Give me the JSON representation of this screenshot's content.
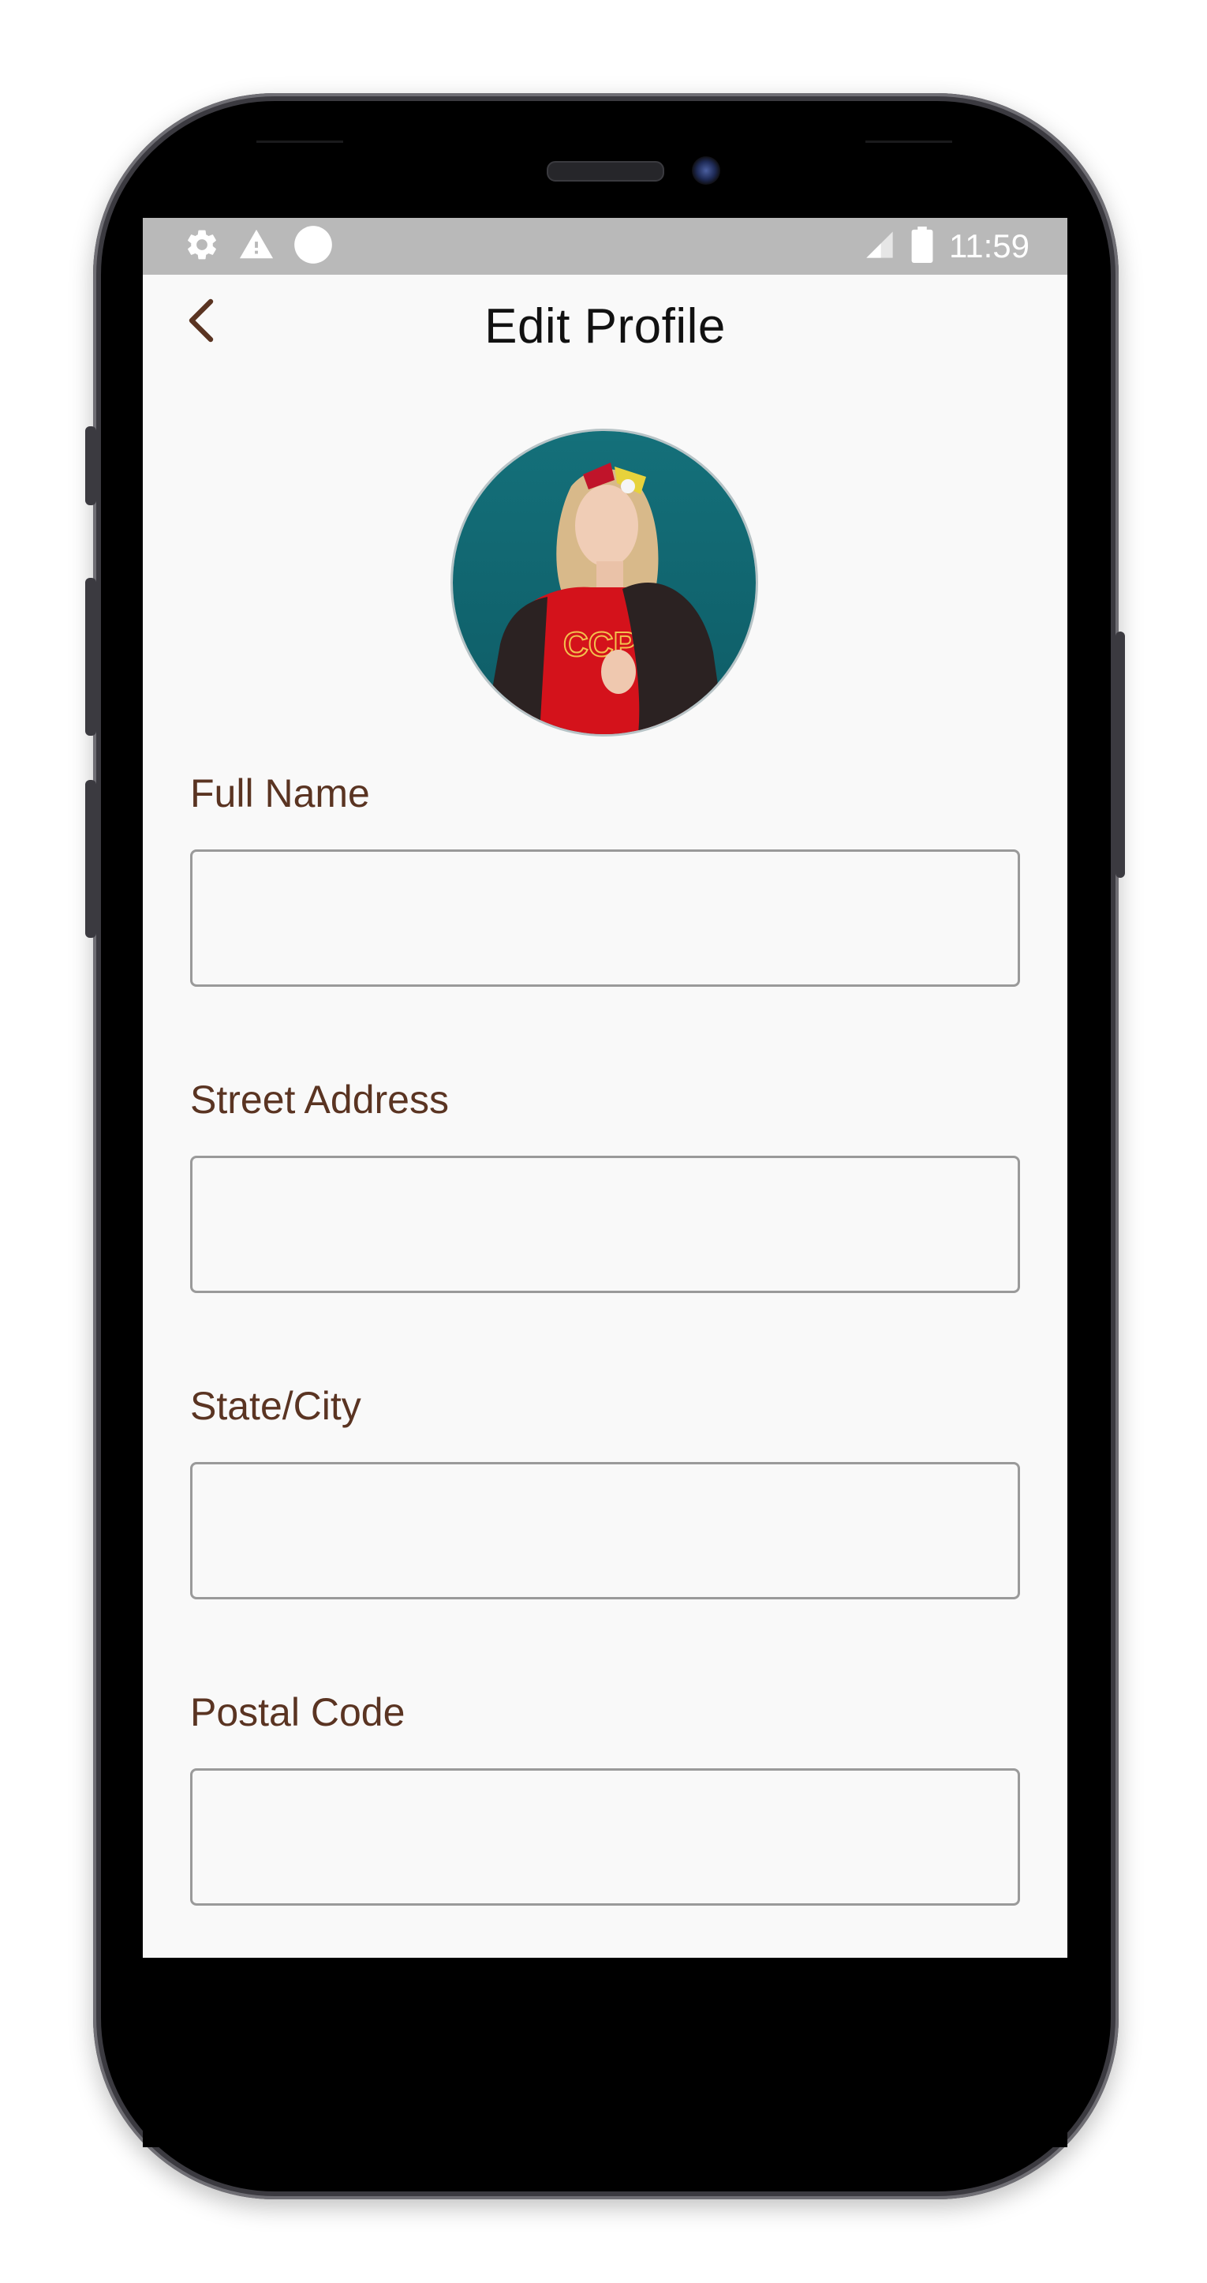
{
  "status_bar": {
    "time": "11:59",
    "left_icons": [
      "gear-icon",
      "warning-icon",
      "circle-icon"
    ],
    "right_icons": [
      "signal-icon",
      "battery-icon"
    ]
  },
  "header": {
    "title": "Edit Profile",
    "back_icon": "chevron-left-icon"
  },
  "avatar": {
    "alt": "profile photo"
  },
  "form": {
    "fields": [
      {
        "label": "Full Name",
        "value": "",
        "placeholder": ""
      },
      {
        "label": "Street Address",
        "value": "",
        "placeholder": ""
      },
      {
        "label": "State/City",
        "value": "",
        "placeholder": ""
      },
      {
        "label": "Postal Code",
        "value": "",
        "placeholder": ""
      }
    ]
  },
  "colors": {
    "label": "#5a3422",
    "back_icon": "#5a3422",
    "status_bar": "#b9b9b9",
    "screen_bg": "#f9f9f9",
    "input_border": "#9a9a9a",
    "phone_frame": "#3b3a40"
  }
}
